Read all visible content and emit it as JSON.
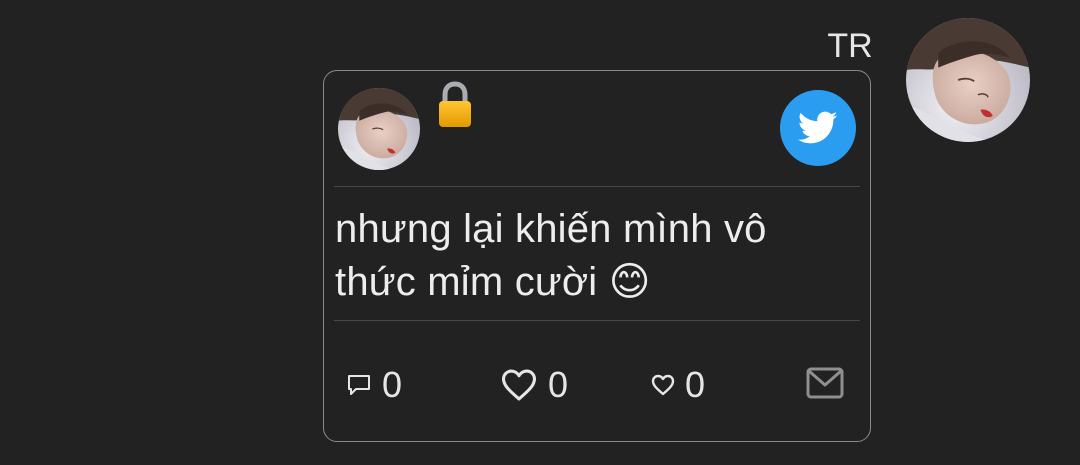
{
  "sender": {
    "initials": "TR",
    "avatar_icon": "profile-photo"
  },
  "card": {
    "author_avatar_icon": "profile-photo",
    "lock_icon": "lock-icon",
    "platform_icon": "twitter-bird-icon",
    "platform_color": "#2b9df0",
    "text": "nhưng lại khiến mình vô thức mỉm cười 😊",
    "stats": {
      "comments": "0",
      "likes": "0",
      "small_likes": "0"
    },
    "mail_icon": "mail-icon"
  },
  "colors": {
    "background": "#222222",
    "card_border": "#8a8a8a",
    "text": "#ededed"
  }
}
